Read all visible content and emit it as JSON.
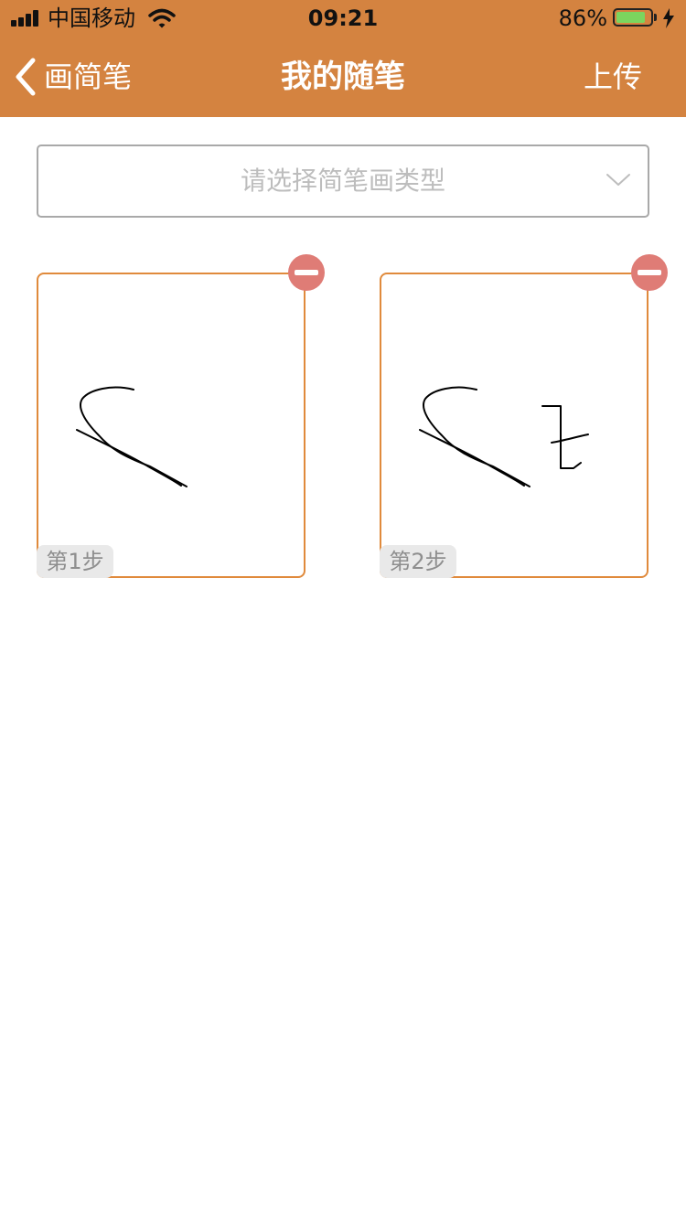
{
  "status_bar": {
    "carrier": "中国移动",
    "time": "09:21",
    "battery_percent": "86%",
    "battery_level": 0.86,
    "charging": true
  },
  "nav": {
    "back_label": "画简笔",
    "title": "我的随笔",
    "upload_label": "上传"
  },
  "type_select": {
    "placeholder": "请选择简笔画类型"
  },
  "steps": [
    {
      "label": "第1步"
    },
    {
      "label": "第2步"
    }
  ],
  "colors": {
    "header_bg": "#D48340",
    "card_border": "#E08A3C",
    "delete_button": "#DF7C76",
    "battery_fill": "#7BD55E"
  }
}
